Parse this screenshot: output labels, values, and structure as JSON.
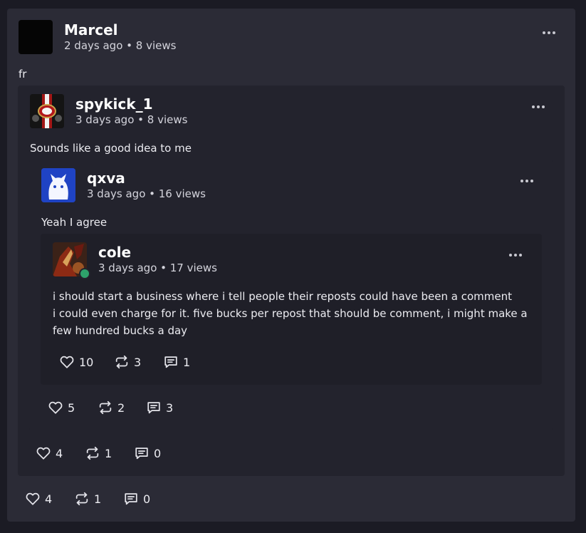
{
  "post": {
    "author": "Marcel",
    "meta": "2 days ago • 8 views",
    "text": "fr",
    "likes": "4",
    "reposts": "1",
    "comments": "0",
    "repost1": {
      "author": "spykick_1",
      "meta": "3 days ago • 8 views",
      "text": "Sounds like a good idea to me",
      "likes": "4",
      "reposts": "1",
      "comments": "0",
      "repost2": {
        "author": "qxva",
        "meta": "3 days ago • 16 views",
        "text": "Yeah I agree",
        "likes": "5",
        "reposts": "2",
        "comments": "3",
        "repost3": {
          "author": "cole",
          "meta": "3 days ago • 17 views",
          "text_line1": "i should start a business where i tell people their reposts could have been a comment",
          "text_line2": "i could even charge for it. five bucks per repost that should be comment, i might make a few hundred bucks a day",
          "likes": "10",
          "reposts": "3",
          "comments": "1",
          "online_status_color": "#2ea26b"
        }
      }
    }
  },
  "icons": {
    "like": "heart-icon",
    "repost": "repost-icon",
    "comment": "comment-icon",
    "more": "more-options-icon"
  },
  "colors": {
    "page_bg": "#1b1b24",
    "card_bg": "#2b2b36",
    "repost_bg": "#23232d",
    "online": "#2ea26b"
  }
}
